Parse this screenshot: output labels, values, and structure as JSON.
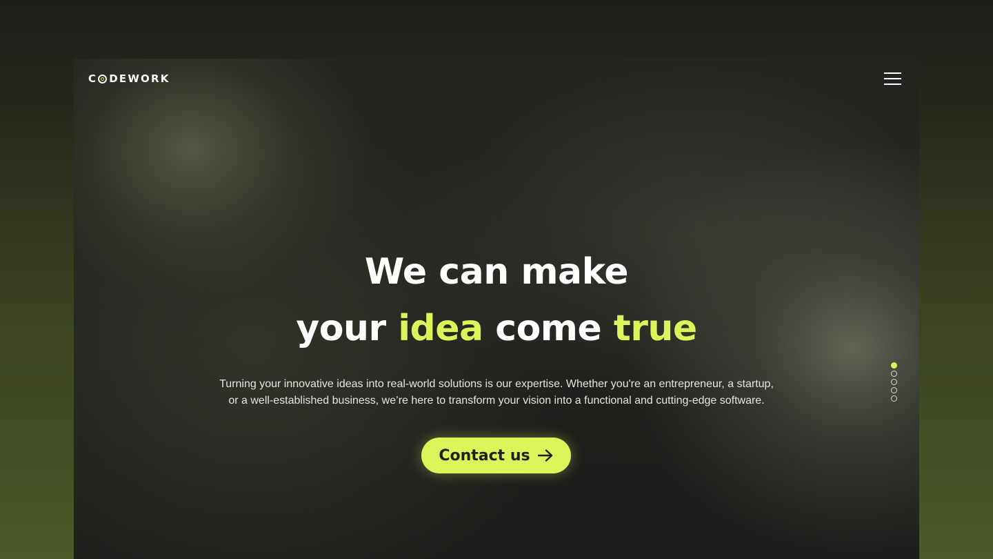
{
  "brand": {
    "logo_prefix": "C",
    "logo_suffix": "DEWORK"
  },
  "nav": {
    "menu_icon": "hamburger-menu-icon"
  },
  "hero": {
    "headline_line1": "We can make",
    "headline_line2_part1": "your ",
    "headline_line2_accent1": "idea",
    "headline_line2_part2": " come ",
    "headline_line2_accent2": "true",
    "subtitle_line1": "Turning your innovative ideas into real-world solutions is our expertise. Whether you're an entrepreneur, a startup,",
    "subtitle_line2": "or a well-established business, we’re here to transform your vision into a functional and cutting-edge software.",
    "cta_label": "Contact us",
    "cta_icon": "arrow-right-icon"
  },
  "pagination": {
    "count": 5,
    "active_index": 0
  },
  "colors": {
    "accent": "#dcf35a",
    "text": "#ffffff",
    "background": "#1d1e1b"
  }
}
